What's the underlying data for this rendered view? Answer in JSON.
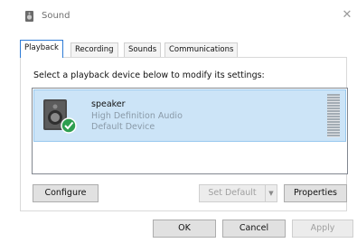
{
  "window": {
    "title": "Sound",
    "icon": "speaker-icon",
    "close_icon": "close-icon"
  },
  "tabs": [
    {
      "label": "Playback",
      "active": true
    },
    {
      "label": "Recording",
      "active": false
    },
    {
      "label": "Sounds",
      "active": false
    },
    {
      "label": "Communications",
      "active": false
    }
  ],
  "playback": {
    "instruction": "Select a playback device below to modify its settings:",
    "devices": [
      {
        "name": "speaker",
        "description": "High Definition Audio",
        "status": "Default Device",
        "icon": "speaker-device-icon",
        "badge": "default-check-icon",
        "selected": true
      }
    ]
  },
  "buttons": {
    "configure": "Configure",
    "set_default": "Set Default",
    "set_default_arrow": "▼",
    "properties": "Properties",
    "ok": "OK",
    "cancel": "Cancel",
    "apply": "Apply"
  },
  "colors": {
    "selection_bg": "#cce4f7",
    "active_tab_border": "#2d7bd6",
    "check_badge": "#2e9e4f"
  }
}
